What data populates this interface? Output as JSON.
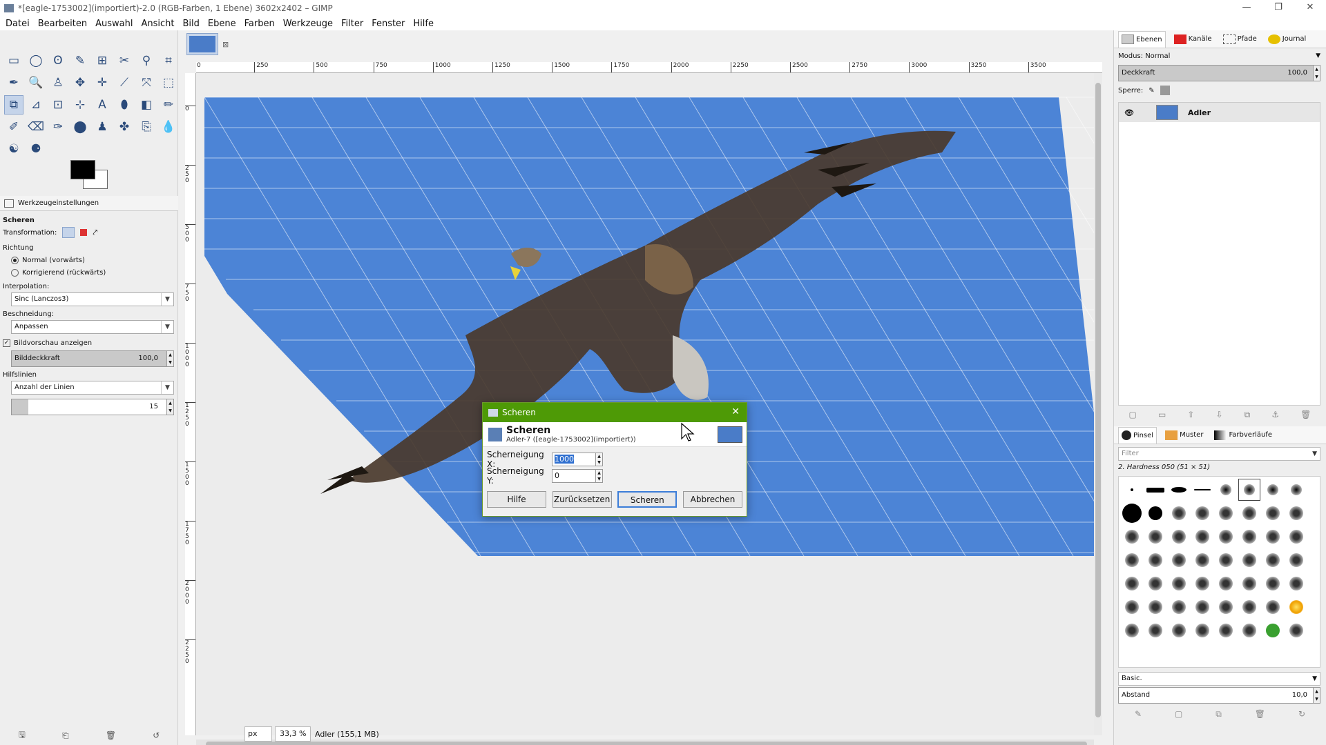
{
  "window": {
    "title": "*[eagle-1753002](importiert)-2.0 (RGB-Farben, 1 Ebene) 3602x2402 – GIMP",
    "controls": [
      "—",
      "❐",
      "✕"
    ]
  },
  "menu": [
    "Datei",
    "Bearbeiten",
    "Auswahl",
    "Ansicht",
    "Bild",
    "Ebene",
    "Farben",
    "Werkzeuge",
    "Filter",
    "Fenster",
    "Hilfe"
  ],
  "toolbox": {
    "tools": [
      "▭",
      "◯",
      "ʘ",
      "✎",
      "⊞",
      "✂",
      "⚲",
      "⌗",
      "✒",
      "🔍",
      "♙",
      "✥",
      "✛",
      "⟋",
      "⤧",
      "⬚",
      "⧉",
      "⊿",
      "⊡",
      "⊹",
      "A",
      "⬮",
      "◧",
      "✏",
      "✐",
      "⌫",
      "✑",
      "⬤",
      "♟",
      "✤",
      "⎘",
      "💧",
      "☯",
      "⚈"
    ],
    "options_tab": "Werkzeugeinstellungen",
    "tool_name": "Scheren",
    "transformation_label": "Transformation:",
    "direction_label": "Richtung",
    "direction_normal": "Normal (vorwärts)",
    "direction_corrective": "Korrigierend (rückwärts)",
    "interpolation_label": "Interpolation:",
    "interpolation_value": "Sinc (Lanczos3)",
    "clipping_label": "Beschneidung:",
    "clipping_value": "Anpassen",
    "preview_label": "Bildvorschau anzeigen",
    "opacity_label": "Bilddeckkraft",
    "opacity_value": "100,0",
    "guides_label": "Hilfslinien",
    "guides_value": "Anzahl der Linien",
    "lines_value": "15"
  },
  "canvas": {
    "ruler_labels": [
      "0",
      "250",
      "500",
      "750",
      "1000",
      "1250",
      "1500",
      "1750",
      "2000",
      "2250",
      "2500",
      "2750",
      "3000",
      "3250",
      "3500"
    ],
    "vruler_labels": [
      "0",
      "2\n5\n0",
      "5\n0\n0",
      "7\n5\n0",
      "1\n0\n0\n0",
      "1\n2\n5\n0",
      "1\n5\n0\n0",
      "1\n7\n5\n0",
      "2\n0\n0\n0",
      "2\n2\n5\n0"
    ],
    "sky_color": "#4c84d6"
  },
  "status": {
    "unit": "px",
    "zoom": "33,3 %",
    "info": "Adler (155,1 MB)"
  },
  "dock": {
    "tabs": [
      "Ebenen",
      "Kanäle",
      "Pfade",
      "Journal"
    ],
    "mode_label": "Modus: Normal",
    "opacity_label": "Deckkraft",
    "opacity_value": "100,0",
    "lock_label": "Sperre:",
    "layer_name": "Adler",
    "brush_tabs": [
      "Pinsel",
      "Muster",
      "Farbverläufe"
    ],
    "filter_placeholder": "Filter",
    "brush_name": "2. Hardness 050 (51 × 51)",
    "brush_preset": "Basic.",
    "spacing_label": "Abstand",
    "spacing_value": "10,0"
  },
  "dialog": {
    "title": "Scheren",
    "heading": "Scheren",
    "subheading": "Adler-7 ([eagle-1753002](importiert))",
    "field_x_label": "Scherneigung X:",
    "field_x_value": "1000",
    "field_y_label": "Scherneigung Y:",
    "field_y_value": "0",
    "btn_help": "Hilfe",
    "btn_reset": "Zurücksetzen",
    "btn_shear": "Scheren",
    "btn_cancel": "Abbrechen"
  }
}
